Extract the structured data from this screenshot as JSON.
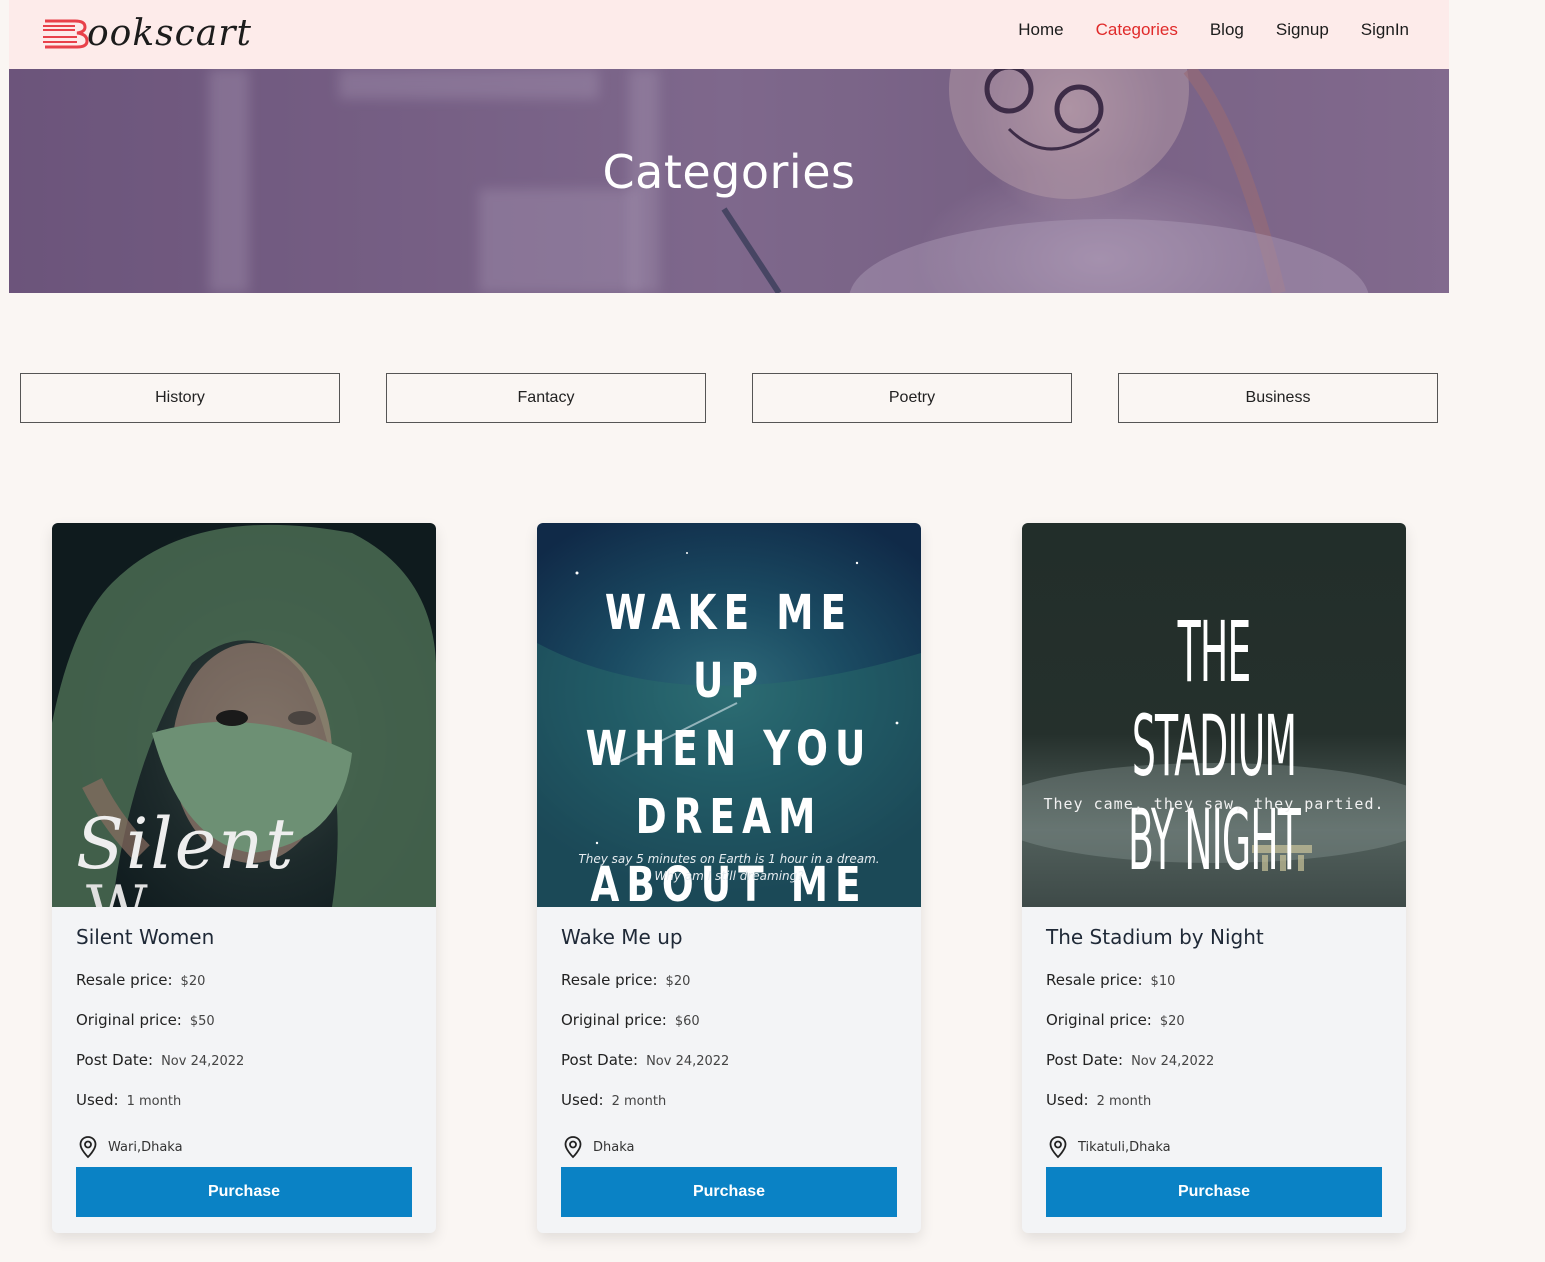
{
  "brand": {
    "logo_text": "ookscart",
    "accent": "#e02a2a"
  },
  "nav": {
    "items": [
      {
        "label": "Home",
        "active": false
      },
      {
        "label": "Categories",
        "active": true
      },
      {
        "label": "Blog",
        "active": false
      },
      {
        "label": "Signup",
        "active": false
      },
      {
        "label": "SignIn",
        "active": false
      }
    ]
  },
  "hero": {
    "title": "Categories"
  },
  "categories": [
    "History",
    "Fantacy",
    "Poetry",
    "Business"
  ],
  "labels": {
    "resale": "Resale price:",
    "original": "Original price:",
    "post_date": "Post Date:",
    "used": "Used:",
    "purchase": "Purchase"
  },
  "books": [
    {
      "title": "Silent Women",
      "resale": "$20",
      "original": "$50",
      "post_date": "Nov 24,2022",
      "used": "1 month",
      "location": "Wari,Dhaka",
      "cover": {
        "title_line1": "Silent",
        "title_line2": "W"
      }
    },
    {
      "title": "Wake Me up",
      "resale": "$20",
      "original": "$60",
      "post_date": "Nov 24,2022",
      "used": "2 month",
      "location": "Dhaka",
      "cover": {
        "lines": [
          "WAKE ME UP",
          "WHEN YOU",
          "DREAM",
          "ABOUT ME"
        ],
        "tagline1": "They say 5 minutes on Earth is 1 hour in a dream.",
        "tagline2": "Why am I still dreaming?"
      }
    },
    {
      "title": "The Stadium by Night",
      "resale": "$10",
      "original": "$20",
      "post_date": "Nov 24,2022",
      "used": "2 month",
      "location": "Tikatuli,Dhaka",
      "cover": {
        "line1": "THE STADIUM",
        "line2": "BY NIGHT",
        "tagline": "They came, they saw, they partied."
      }
    }
  ],
  "colors": {
    "purchase_button": "#0a82c5",
    "navbar_bg": "#fdebea",
    "page_bg": "#faf6f3"
  }
}
